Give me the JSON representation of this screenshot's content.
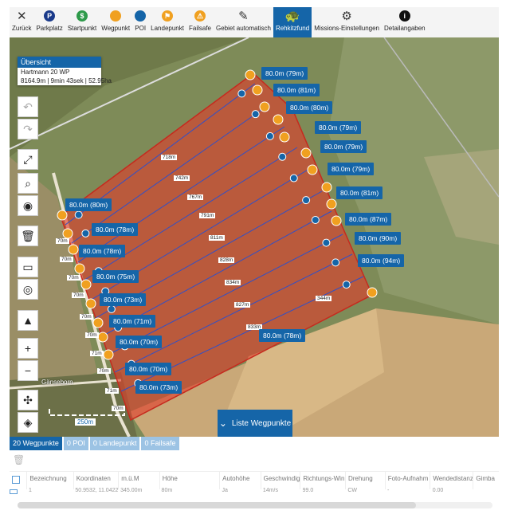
{
  "toolbar": [
    {
      "id": "back",
      "label": "Zurück",
      "icon": "close-icon"
    },
    {
      "id": "parking",
      "label": "Parkplatz",
      "icon": "parking-icon",
      "color": "#1a3a8a"
    },
    {
      "id": "start",
      "label": "Startpunkt",
      "icon": "start-icon",
      "color": "#2e9a4a"
    },
    {
      "id": "waypoint",
      "label": "Wegpunkt",
      "icon": "waypoint-icon",
      "color": "#f0a020"
    },
    {
      "id": "poi",
      "label": "POI",
      "icon": "poi-icon",
      "color": "#1565a8"
    },
    {
      "id": "landing",
      "label": "Landepunkt",
      "icon": "landing-icon",
      "color": "#f0a020"
    },
    {
      "id": "failsafe",
      "label": "Failsafe",
      "icon": "failsafe-icon",
      "color": "#f0a020"
    },
    {
      "id": "auto",
      "label": "Gebiet automatisch",
      "icon": "area-auto-icon"
    },
    {
      "id": "fawn",
      "label": "Rehkitzfund",
      "icon": "turtle-icon",
      "active": true
    },
    {
      "id": "missions",
      "label": "Missions-Einstellungen",
      "icon": "gear-icon"
    },
    {
      "id": "details",
      "label": "Detailangaben",
      "icon": "info-icon"
    }
  ],
  "overview": {
    "title": "Übersicht",
    "name": "Hartmann 20 WP",
    "stats": "8164.9m | 9min 43sek | 52.95ha"
  },
  "map": {
    "street_labels": [
      "Gänseborn"
    ],
    "scale_label": "250m",
    "waypoint_labels": [
      "80.0m (79m)",
      "80.0m (81m)",
      "80.0m (80m)",
      "80.0m (79m)",
      "80.0m (79m)",
      "80.0m (79m)",
      "80.0m (81m)",
      "80.0m (87m)",
      "80.0m (90m)",
      "80.0m (94m)",
      "80.0m (80m)",
      "80.0m (78m)",
      "80.0m (78m)",
      "80.0m (75m)",
      "80.0m (73m)",
      "80.0m (71m)",
      "80.0m (70m)",
      "80.0m (70m)",
      "80.0m (73m)",
      "80.0m (78m)"
    ],
    "distance_labels": [
      "718m",
      "742m",
      "767m",
      "791m",
      "811m",
      "828m",
      "834m",
      "827m",
      "833m",
      "344m",
      "70m",
      "70m",
      "70m",
      "70m",
      "70m",
      "70m",
      "71m",
      "70m",
      "71m",
      "70m"
    ],
    "colors": {
      "area": "#e23a2a",
      "waypoint": "#f0a020",
      "label": "#1565a8"
    }
  },
  "list_button": "Liste Wegpunkte",
  "tabs": [
    {
      "label": "20 Wegpunkte",
      "active": true
    },
    {
      "label": "0 POI"
    },
    {
      "label": "0 Landepunkt"
    },
    {
      "label": "0 Failsafe"
    }
  ],
  "table": {
    "headers": [
      "Bezeichnung",
      "Koordinaten",
      "m.ü.M",
      "Höhe",
      "Autohöhe",
      "Geschwindigk",
      "Richtungs-Win",
      "Drehung",
      "Foto-Aufnahm",
      "Wendedistanz",
      "Gimba"
    ],
    "row": [
      "1",
      "50.9532, 11.0422",
      "345.00m",
      "80m",
      "Ja",
      "14m/s",
      "99.0",
      "CW",
      "-",
      "0.00",
      ""
    ]
  }
}
